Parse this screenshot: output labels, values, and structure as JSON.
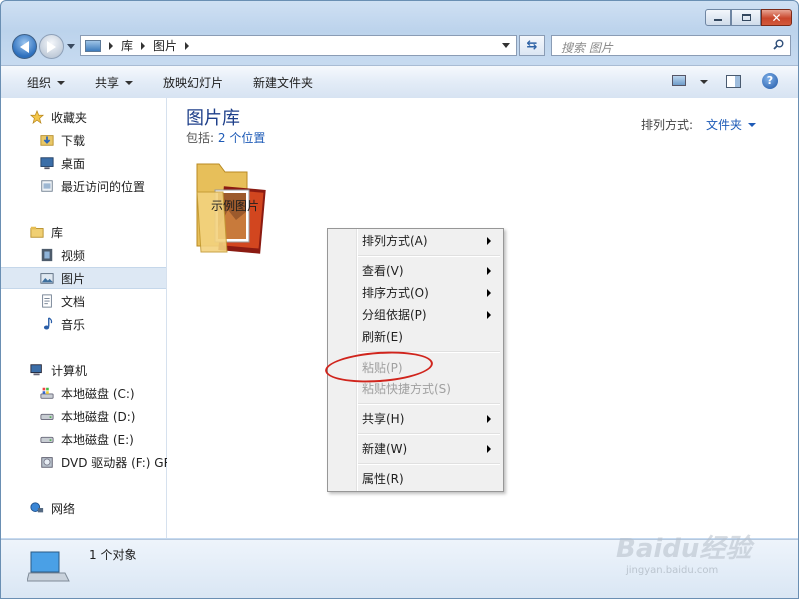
{
  "window": {
    "address": {
      "crumbs": [
        "库",
        "图片"
      ]
    },
    "search": {
      "placeholder": "搜索 图片"
    }
  },
  "toolbar": {
    "organize": "组织",
    "share": "共享",
    "slideshow": "放映幻灯片",
    "new_folder": "新建文件夹"
  },
  "sidebar": {
    "favorites": "收藏夹",
    "downloads": "下载",
    "desktop": "桌面",
    "recent": "最近访问的位置",
    "libraries": "库",
    "videos": "视频",
    "pictures": "图片",
    "documents": "文档",
    "music": "音乐",
    "computer": "计算机",
    "disk_c": "本地磁盘 (C:)",
    "disk_d": "本地磁盘 (D:)",
    "disk_e": "本地磁盘 (E:)",
    "dvd": "DVD 驱动器 (F:) GR",
    "network": "网络"
  },
  "content": {
    "title": "图片库",
    "includes_label": "包括:",
    "includes_link": "2 个位置",
    "arrange_label": "排列方式:",
    "arrange_value": "文件夹",
    "folder_name": "示例图片"
  },
  "status": {
    "text": "1 个对象"
  },
  "context_menu": {
    "items": [
      {
        "label": "排列方式(A)",
        "submenu": true
      },
      {
        "label": "查看(V)",
        "submenu": true
      },
      {
        "label": "排序方式(O)",
        "submenu": true
      },
      {
        "label": "分组依据(P)",
        "submenu": true
      },
      {
        "label": "刷新(E)",
        "submenu": false
      },
      {
        "label": "粘贴(P)",
        "disabled": true
      },
      {
        "label": "粘贴快捷方式(S)",
        "disabled": true
      },
      {
        "label": "共享(H)",
        "submenu": true
      },
      {
        "label": "新建(W)",
        "submenu": true
      },
      {
        "label": "属性(R)",
        "submenu": false
      }
    ]
  },
  "watermark": {
    "text": "Baidu经验",
    "sub": "jingyan.baidu.com"
  },
  "colors": {
    "accent_link": "#1e5bb7",
    "highlight_circle": "#d0241c"
  }
}
